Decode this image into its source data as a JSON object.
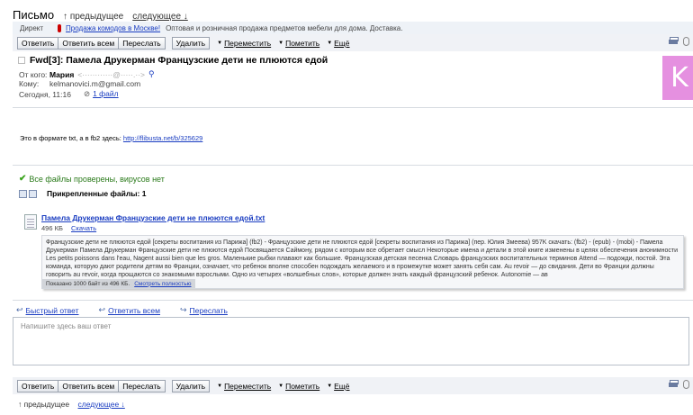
{
  "header": {
    "title": "Письмо",
    "prev_label": "↑ предыдущее",
    "next_label": "следующее ↓"
  },
  "adbar": {
    "label": "Директ",
    "link": "Продажа комодов в Москве!",
    "text": "Оптовая и розничная продажа предметов мебели для дома. Доставка."
  },
  "toolbar": {
    "reply": "Ответить",
    "reply_all": "Ответить всем",
    "forward": "Переслать",
    "delete": "Удалить",
    "move": "Переместить",
    "mark": "Пометить",
    "more": "Ещё"
  },
  "message": {
    "subject": "Fwd[3]: Памела Друкерман Французские дети не плюются едой",
    "from_label": "От кого:",
    "from_name": "Мария",
    "from_email": "<············@·····.··>",
    "to_label": "Кому:",
    "to_email": "kelmanovici.m@gmail.com",
    "date": "Сегодня, 11:16",
    "attachments_count": "1 файл",
    "avatar_letter": "K",
    "body_text": "Это в формате txt, а в fb2 здесь:",
    "body_link": "http://flibusta.net/b/325629"
  },
  "attachments": {
    "virus_status": "Все файлы проверены, вирусов нет",
    "heading": "Прикрепленные файлы: 1",
    "file": {
      "name": "Памела Друкерман Французские дети не плюются едой.txt",
      "size": "496 КБ",
      "download": "Скачать",
      "preview_text": "Французские дети не плюются едой [секреты воспитания из Парижа] (fb2) - Французские дети не плюются едой [секреты воспитания из Парижа] (пер. Юлия Змеева) 957K скачать: (fb2) - (epub) - (mobi) - Памела Друкерман Памела Друкерман Французские дети не плюются едой Посвящается Саймону, рядом с которым все обретает смысл Некоторые имена и детали в этой книге изменены в целях обеспечения анонимности Les petits poissons dans l'eau, Nagent aussi bien que les gros. Маленькие рыбки плавают как большие. Французская детская песенка Словарь французских воспитательных терминов Attend — подожди, постой. Эта команда, которую дают родители детям во Франции, означает, что ребенок вполне способен подождать желаемого и в промежутке может занять себя сам. Au revoir — до свидания. Дети во Франции должны говорить au revoir, когда прощаются со знакомыми взрослыми. Одно из четырех «волшебных слов», которые должен знать каждый французский ребенок. Autonomie — ав",
      "preview_shown": "Показано 1000 байт из 496 КБ.",
      "preview_full": "Смотреть полностью"
    }
  },
  "reply": {
    "quick": "Быстрый ответ",
    "reply_all": "Ответить всем",
    "forward": "Переслать",
    "placeholder": "Напишите здесь ваш ответ"
  },
  "footer": {
    "prev_label": "↑ предыдущее",
    "next_label": "следующее ↓"
  }
}
